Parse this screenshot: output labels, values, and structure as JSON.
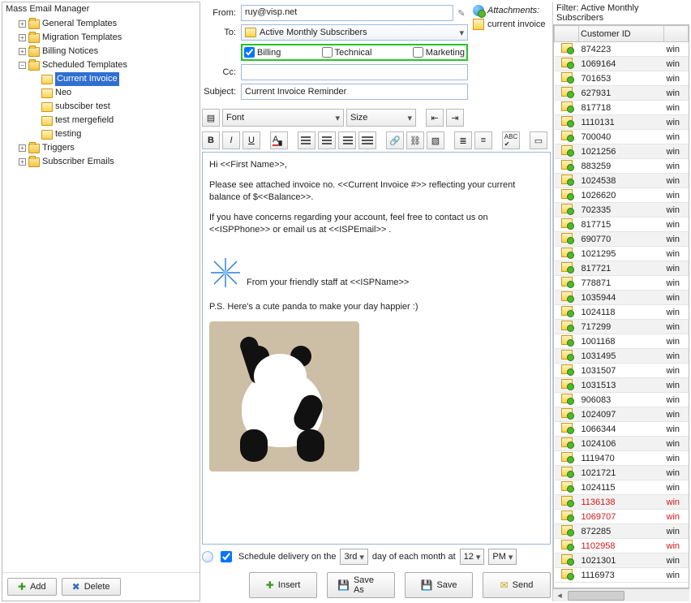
{
  "left": {
    "title": "Mass Email Manager",
    "nodes": [
      {
        "label": "General Templates",
        "type": "folder",
        "expand": "▷"
      },
      {
        "label": "Migration Templates",
        "type": "folder",
        "expand": "▷"
      },
      {
        "label": "Billing Notices",
        "type": "folder",
        "expand": "▷"
      },
      {
        "label": "Scheduled Templates",
        "type": "folder",
        "expand": "◢",
        "children": [
          {
            "label": "Current Invoice",
            "selected": true
          },
          {
            "label": "Neo"
          },
          {
            "label": "subsciber test"
          },
          {
            "label": "test mergefield"
          },
          {
            "label": "testing"
          }
        ]
      },
      {
        "label": "Triggers",
        "type": "folder",
        "expand": "▷"
      },
      {
        "label": "Subscriber Emails",
        "type": "folder",
        "expand": "▷"
      }
    ],
    "add": "Add",
    "delete": "Delete"
  },
  "form": {
    "from_label": "From:",
    "from": "ruy@visp.net",
    "to_label": "To:",
    "to_select": "Active Monthly Subscribers",
    "billing": "Billing",
    "technical": "Technical",
    "marketing": "Marketing",
    "cc_label": "Cc:",
    "cc": "",
    "subject_label": "Subject:",
    "subject": "Current Invoice Reminder",
    "attachments_label": "Attachments:",
    "attachment_name": "current invoice"
  },
  "editor": {
    "font_ph": "Font",
    "size_ph": "Size",
    "greeting": "Hi <<First Name>>,",
    "p1": "Please see attached invoice no. <<Current Invoice #>> reflecting your current balance of $<<Balance>>.",
    "p2": "If you have concerns regarding your account, feel free to contact us on <<ISPPhone>> or email us at <<ISPEmail>> .",
    "sig": "From your friendly staff at <<ISPName>>",
    "ps": "P.S. Here's a cute panda to make your day happier :)"
  },
  "schedule": {
    "label_a": "Schedule delivery on the ",
    "day": "3rd",
    "label_b": " day of each month at ",
    "hour": "12",
    "ampm": "PM"
  },
  "buttons": {
    "insert": "Insert",
    "saveas": "Save As",
    "save": "Save",
    "send": "Send"
  },
  "right": {
    "title": "Filter: Active Monthly Subscribers",
    "col1": "Customer ID",
    "col2": "win",
    "rows": [
      {
        "id": "874223"
      },
      {
        "id": "1069164"
      },
      {
        "id": "701653"
      },
      {
        "id": "627931"
      },
      {
        "id": "817718"
      },
      {
        "id": "1110131"
      },
      {
        "id": "700040"
      },
      {
        "id": "1021256"
      },
      {
        "id": "883259"
      },
      {
        "id": "1024538"
      },
      {
        "id": "1026620"
      },
      {
        "id": "702335"
      },
      {
        "id": "817715"
      },
      {
        "id": "690770"
      },
      {
        "id": "1021295"
      },
      {
        "id": "817721"
      },
      {
        "id": "778871"
      },
      {
        "id": "1035944"
      },
      {
        "id": "1024118"
      },
      {
        "id": "717299"
      },
      {
        "id": "1001168"
      },
      {
        "id": "1031495"
      },
      {
        "id": "1031507"
      },
      {
        "id": "1031513"
      },
      {
        "id": "906083"
      },
      {
        "id": "1024097"
      },
      {
        "id": "1066344"
      },
      {
        "id": "1024106"
      },
      {
        "id": "1119470"
      },
      {
        "id": "1021721"
      },
      {
        "id": "1024115"
      },
      {
        "id": "1136138",
        "red": true
      },
      {
        "id": "1069707",
        "red": true
      },
      {
        "id": "872285"
      },
      {
        "id": "1102958",
        "red": true
      },
      {
        "id": "1021301"
      },
      {
        "id": "1116973"
      }
    ]
  }
}
